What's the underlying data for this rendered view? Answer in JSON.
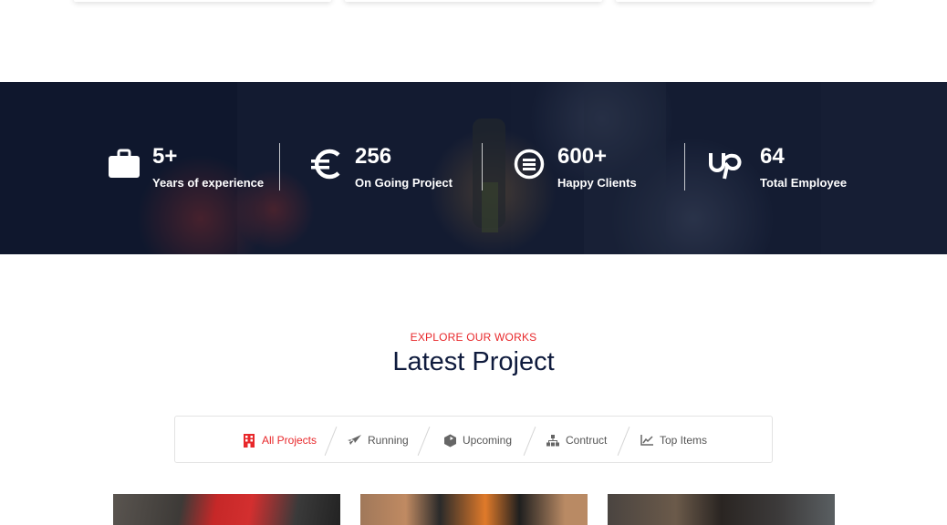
{
  "stats": [
    {
      "icon": "briefcase-icon",
      "number": "5+",
      "label": "Years of experience"
    },
    {
      "icon": "euro-icon",
      "number": "256",
      "label": "On Going Project"
    },
    {
      "icon": "circle-lines-icon",
      "number": "600+",
      "label": "Happy Clients"
    },
    {
      "icon": "upwork-icon",
      "number": "64",
      "label": "Total Employee"
    }
  ],
  "section": {
    "eyebrow": "EXPLORE OUR WORKS",
    "title": "Latest Project"
  },
  "filters": [
    {
      "icon": "building-icon",
      "label": "All Projects",
      "active": true
    },
    {
      "icon": "rocket-icon",
      "label": "Running",
      "active": false
    },
    {
      "icon": "box-icon",
      "label": "Upcoming",
      "active": false
    },
    {
      "icon": "sitemap-icon",
      "label": "Contruct",
      "active": false
    },
    {
      "icon": "chart-line-icon",
      "label": "Top Items",
      "active": false
    }
  ],
  "colors": {
    "accent": "#e8282b",
    "heading": "#0f1b3d",
    "banner_overlay": "#0c1630"
  }
}
